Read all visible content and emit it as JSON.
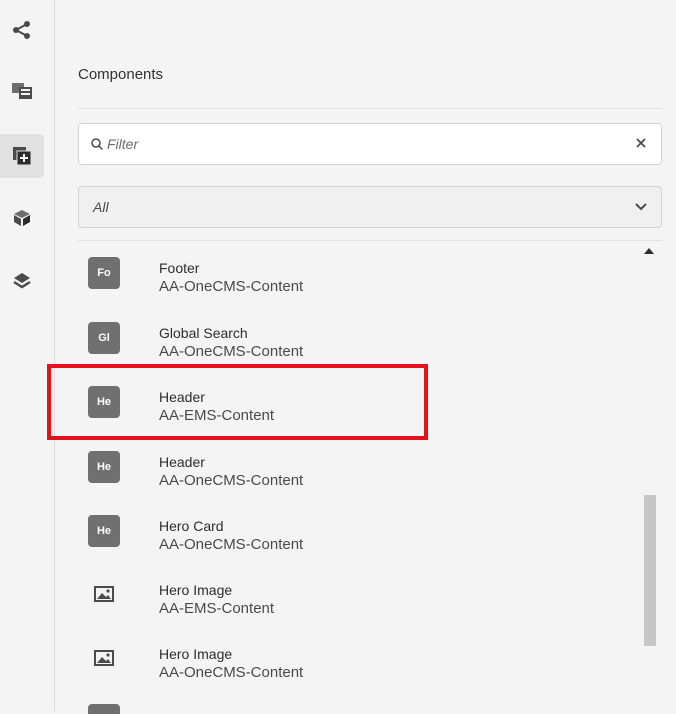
{
  "panel": {
    "title": "Components"
  },
  "search": {
    "placeholder": "Filter",
    "value": ""
  },
  "group_select": {
    "selected": "All"
  },
  "rail": {
    "items": [
      {
        "icon": "share-icon"
      },
      {
        "icon": "assets-icon"
      },
      {
        "icon": "components-icon",
        "active": true
      },
      {
        "icon": "content-tree-icon"
      },
      {
        "icon": "layers-icon"
      }
    ]
  },
  "components": [
    {
      "badge": "Fo",
      "name": "Footer",
      "group": "AA-OneCMS-Content"
    },
    {
      "badge": "Gl",
      "name": "Global Search",
      "group": "AA-OneCMS-Content"
    },
    {
      "badge": "He",
      "name": "Header",
      "group": "AA-EMS-Content",
      "highlighted": true
    },
    {
      "badge": "He",
      "name": "Header",
      "group": "AA-OneCMS-Content"
    },
    {
      "badge": "He",
      "name": "Hero Card",
      "group": "AA-OneCMS-Content"
    },
    {
      "badge": "image-icon",
      "name": "Hero Image",
      "group": "AA-EMS-Content"
    },
    {
      "badge": "image-icon",
      "name": "Hero Image",
      "group": "AA-OneCMS-Content"
    }
  ],
  "colors": {
    "highlight": "#e1141c",
    "badge": "#707070",
    "background": "#f4f4f4"
  }
}
